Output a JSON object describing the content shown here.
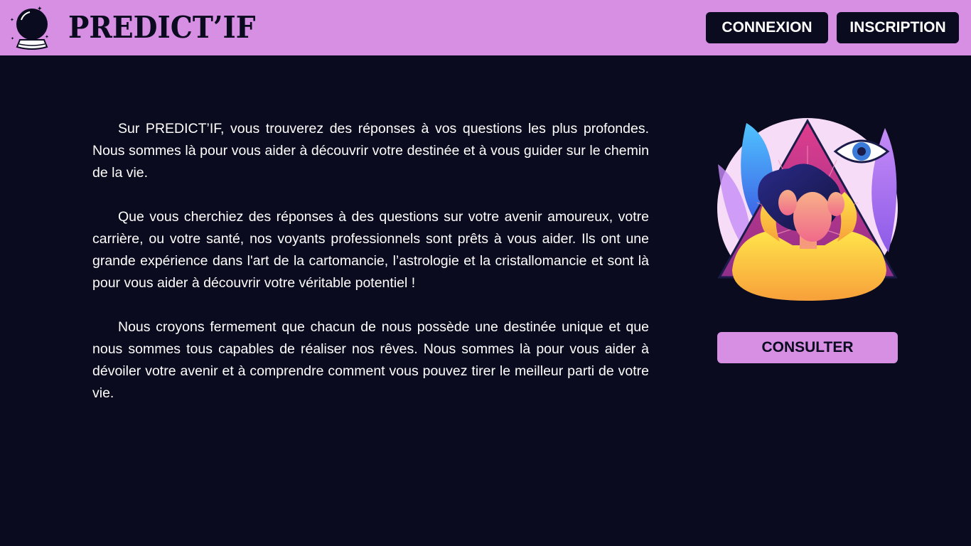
{
  "brand": {
    "name": "PREDICT’IF",
    "logo_icon": "crystal-ball-icon"
  },
  "nav": {
    "connexion_label": "CONNEXION",
    "inscription_label": "INSCRIPTION"
  },
  "main": {
    "paragraphs": [
      "Sur PREDICT’IF, vous trouverez des réponses à vos questions les plus profondes. Nous sommes là pour vous aider à découvrir votre destinée et à vous guider sur le chemin de la vie.",
      "Que vous cherchiez des réponses à des questions sur votre avenir amoureux, votre carrière, ou votre santé, nos voyants professionnels sont prêts à vous aider. Ils ont une grande expérience dans l'art de la cartomancie, l’astrologie et la cristallomancie et sont là pour vous aider à découvrir votre véritable potentiel !",
      "Nous croyons fermement que chacun de nous possède une destinée unique et que nous sommes tous capables de réaliser nos rêves. Nous sommes là pour vous aider à dévoiler votre avenir et à comprendre comment vous pouvez tirer le meilleur parti de votre vie."
    ],
    "consult_label": "CONSULTER",
    "illustration_icon": "mystic-eye-illustration"
  },
  "colors": {
    "background": "#0a0b1e",
    "accent": "#d78fe3",
    "text": "#ffffff"
  }
}
